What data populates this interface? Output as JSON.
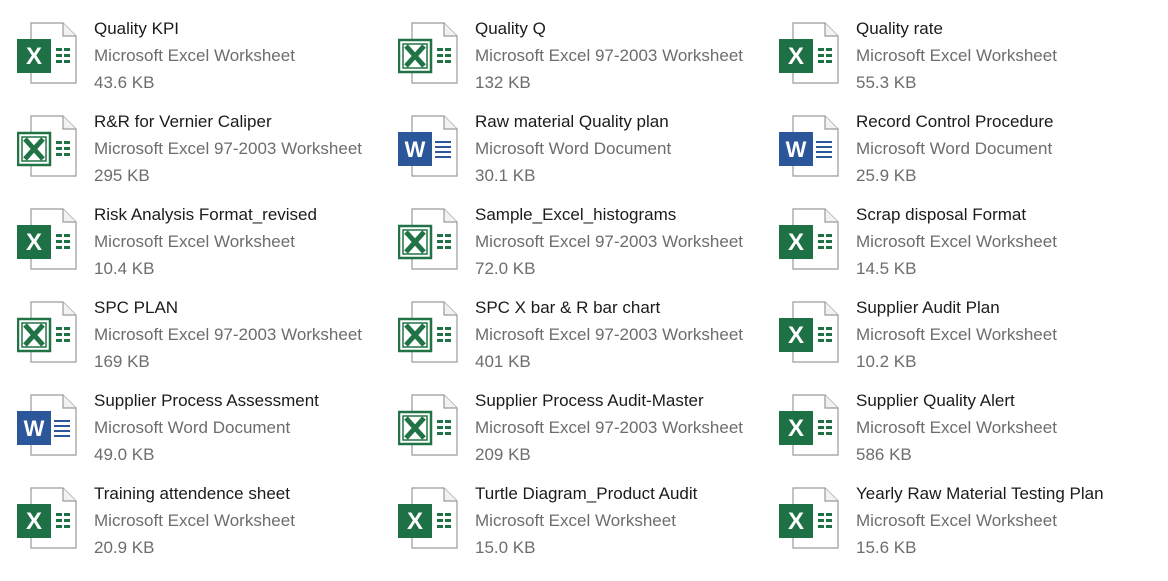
{
  "colors": {
    "excel_green": "#1e7145",
    "excel_legacy_green": "#217346",
    "word_blue": "#2b579a",
    "text_primary": "#1b1b1b",
    "text_secondary": "#6d6d6d"
  },
  "files": [
    {
      "name": "Quality KPI",
      "type": "Microsoft Excel Worksheet",
      "size": "43.6 KB",
      "icon": "excel-icon"
    },
    {
      "name": "Quality Q",
      "type": "Microsoft Excel 97-2003 Worksheet",
      "size": "132 KB",
      "icon": "excel-legacy-icon"
    },
    {
      "name": "Quality rate",
      "type": "Microsoft Excel Worksheet",
      "size": "55.3 KB",
      "icon": "excel-icon"
    },
    {
      "name": "R&R for Vernier Caliper",
      "type": "Microsoft Excel 97-2003 Worksheet",
      "size": "295 KB",
      "icon": "excel-legacy-icon"
    },
    {
      "name": "Raw material Quality plan",
      "type": "Microsoft Word Document",
      "size": "30.1 KB",
      "icon": "word-icon"
    },
    {
      "name": "Record Control Procedure",
      "type": "Microsoft Word Document",
      "size": "25.9 KB",
      "icon": "word-icon"
    },
    {
      "name": "Risk Analysis Format_revised",
      "type": "Microsoft Excel Worksheet",
      "size": "10.4 KB",
      "icon": "excel-icon"
    },
    {
      "name": "Sample_Excel_histograms",
      "type": "Microsoft Excel 97-2003 Worksheet",
      "size": "72.0 KB",
      "icon": "excel-legacy-icon"
    },
    {
      "name": "Scrap disposal Format",
      "type": "Microsoft Excel Worksheet",
      "size": "14.5 KB",
      "icon": "excel-icon"
    },
    {
      "name": "SPC PLAN",
      "type": "Microsoft Excel 97-2003 Worksheet",
      "size": "169 KB",
      "icon": "excel-legacy-icon"
    },
    {
      "name": "SPC X bar & R bar chart",
      "type": "Microsoft Excel 97-2003 Worksheet",
      "size": "401 KB",
      "icon": "excel-legacy-icon"
    },
    {
      "name": "Supplier Audit Plan",
      "type": "Microsoft Excel Worksheet",
      "size": "10.2 KB",
      "icon": "excel-icon"
    },
    {
      "name": "Supplier Process Assessment",
      "type": "Microsoft Word Document",
      "size": "49.0 KB",
      "icon": "word-icon"
    },
    {
      "name": "Supplier Process Audit-Master",
      "type": "Microsoft Excel 97-2003 Worksheet",
      "size": "209 KB",
      "icon": "excel-legacy-icon"
    },
    {
      "name": "Supplier Quality Alert",
      "type": "Microsoft Excel Worksheet",
      "size": "586 KB",
      "icon": "excel-icon"
    },
    {
      "name": "Training attendence sheet",
      "type": "Microsoft Excel Worksheet",
      "size": "20.9 KB",
      "icon": "excel-icon"
    },
    {
      "name": "Turtle Diagram_Product Audit",
      "type": "Microsoft Excel Worksheet",
      "size": "15.0 KB",
      "icon": "excel-icon"
    },
    {
      "name": "Yearly Raw Material Testing Plan",
      "type": "Microsoft Excel Worksheet",
      "size": "15.6 KB",
      "icon": "excel-icon"
    }
  ]
}
